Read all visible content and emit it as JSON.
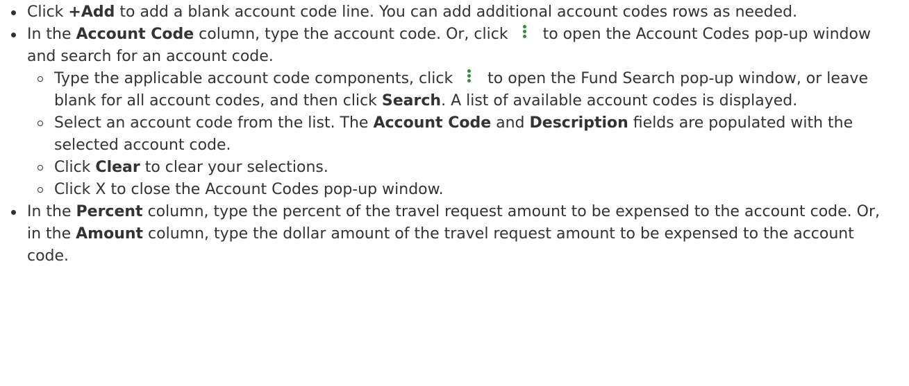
{
  "items": [
    {
      "a": "Click ",
      "b1": "+Add",
      "c": " to add a blank account code line. You can add additional account codes rows as needed."
    },
    {
      "a": "In the ",
      "b1": "Account Code",
      "c": " column, type the account code. Or, click ",
      "d": " to open the Account Codes pop-up window and search for an account code.",
      "sub": [
        {
          "a": "Type the applicable account code components, click ",
          "b": " to open the Fund Search pop-up window, or leave blank for all account codes, and then click ",
          "b1": "Search",
          "c": ". A list of available account codes is displayed."
        },
        {
          "a": "Select an account code from the list. The ",
          "b1": "Account Code",
          "c": " and ",
          "b2": "Description",
          "d": " fields are populated with the selected account code."
        },
        {
          "a": "Click ",
          "b1": "Clear",
          "c": " to clear your selections."
        },
        {
          "a": "Click X to close the Account Codes pop-up window."
        }
      ]
    },
    {
      "a": "In the ",
      "b1": "Percent",
      "c": " column, type the percent of the travel request amount to be expensed to the account code. Or, in the ",
      "b2": "Amount",
      "d": " column, type the dollar amount of the travel request amount to be expensed to the account code."
    }
  ],
  "icons": {
    "lookup": "vertical-ellipsis-icon",
    "lookup_color": "#2e8b3a"
  }
}
